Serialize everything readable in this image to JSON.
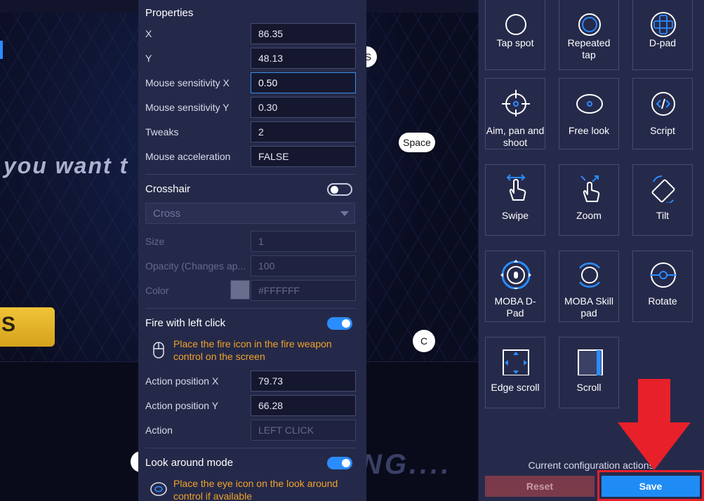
{
  "background": {
    "game_text": "you want t",
    "game_text_2": "NG....",
    "yellow_button": "S",
    "key_s": "S",
    "key_space": "Space",
    "key_c": "C"
  },
  "properties": {
    "title": "Properties",
    "x": {
      "label": "X",
      "value": "86.35"
    },
    "y": {
      "label": "Y",
      "value": "48.13"
    },
    "mouse_sens_x": {
      "label": "Mouse sensitivity X",
      "value": "0.50"
    },
    "mouse_sens_y": {
      "label": "Mouse sensitivity Y",
      "value": "0.30"
    },
    "tweaks": {
      "label": "Tweaks",
      "value": "2"
    },
    "mouse_accel": {
      "label": "Mouse acceleration",
      "value": "FALSE"
    }
  },
  "crosshair": {
    "title": "Crosshair",
    "enabled": false,
    "type": "Cross",
    "size": {
      "label": "Size",
      "value": "1"
    },
    "opacity": {
      "label": "Opacity (Changes ap...",
      "value": "100"
    },
    "color": {
      "label": "Color",
      "value": "#FFFFFF"
    }
  },
  "fire": {
    "title": "Fire with left click",
    "enabled": true,
    "hint": "Place the fire icon in the fire weapon control on the screen",
    "action_x": {
      "label": "Action position X",
      "value": "79.73"
    },
    "action_y": {
      "label": "Action position Y",
      "value": "66.28"
    },
    "action": {
      "label": "Action",
      "value": "LEFT CLICK"
    }
  },
  "look_around": {
    "title": "Look around mode",
    "enabled": true,
    "hint": "Place the eye icon on the look around control if available"
  },
  "controls": [
    {
      "label": "Tap spot",
      "icon": "circle-icon"
    },
    {
      "label": "Repeated tap",
      "icon": "double-circle-icon"
    },
    {
      "label": "D-pad",
      "icon": "dpad-icon"
    },
    {
      "label": "Aim, pan and shoot",
      "icon": "crosshair-icon"
    },
    {
      "label": "Free look",
      "icon": "eye-icon"
    },
    {
      "label": "Script",
      "icon": "code-icon"
    },
    {
      "label": "Swipe",
      "icon": "swipe-hand-icon"
    },
    {
      "label": "Zoom",
      "icon": "zoom-hand-icon"
    },
    {
      "label": "Tilt",
      "icon": "tilt-icon"
    },
    {
      "label": "MOBA D-Pad",
      "icon": "moba-dpad-icon"
    },
    {
      "label": "MOBA Skill pad",
      "icon": "moba-skill-icon"
    },
    {
      "label": "Rotate",
      "icon": "rotate-icon"
    },
    {
      "label": "Edge scroll",
      "icon": "edge-scroll-icon"
    },
    {
      "label": "Scroll",
      "icon": "scroll-icon"
    }
  ],
  "footer": {
    "label": "Current configuration actions",
    "reset": "Reset",
    "save": "Save"
  },
  "colors": {
    "accent": "#1f8cf5",
    "hint": "#f0a32a",
    "highlight": "#e8202a",
    "reset": "#7a3a4a"
  }
}
